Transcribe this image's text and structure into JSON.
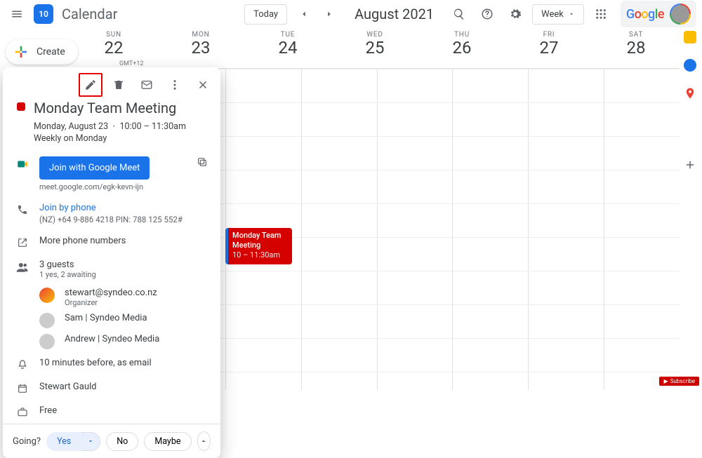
{
  "header": {
    "logo_num": "10",
    "app_title": "Calendar",
    "today_label": "Today",
    "month_title": "August 2021",
    "view_label": "Week",
    "google": [
      "G",
      "o",
      "o",
      "g",
      "l",
      "e"
    ]
  },
  "create_label": "Create",
  "timezone": "GMT+12",
  "days": [
    {
      "dow": "SUN",
      "num": "22"
    },
    {
      "dow": "MON",
      "num": "23"
    },
    {
      "dow": "TUE",
      "num": "24"
    },
    {
      "dow": "WED",
      "num": "25"
    },
    {
      "dow": "THU",
      "num": "26"
    },
    {
      "dow": "FRI",
      "num": "27"
    },
    {
      "dow": "SAT",
      "num": "28"
    }
  ],
  "event_chip": {
    "title": "Monday Team Meeting",
    "time": "10 – 11:30am"
  },
  "popover": {
    "title": "Monday Team Meeting",
    "subtitle": "Monday, August 23  ⋅  10:00 – 11:30am",
    "recur": "Weekly on Monday",
    "meet_btn": "Join with Google Meet",
    "meet_link": "meet.google.com/egk-kevn-ijn",
    "phone_label": "Join by phone",
    "phone_detail": "(NZ) +64 9-886 4218 PIN: 788 125 552#",
    "more_phone": "More phone numbers",
    "guests_summary": "3 guests",
    "guests_status": "1 yes, 2 awaiting",
    "guests": [
      {
        "name": "stewart@syndeo.co.nz",
        "sub": "Organizer"
      },
      {
        "name": "Sam | Syndeo Media",
        "sub": ""
      },
      {
        "name": "Andrew | Syndeo Media",
        "sub": ""
      }
    ],
    "reminder": "10 minutes before, as email",
    "calendar_owner": "Stewart Gauld",
    "visibility": "Free",
    "going_q": "Going?",
    "yes": "Yes",
    "no": "No",
    "maybe": "Maybe"
  },
  "subscribe": "Subscribe"
}
